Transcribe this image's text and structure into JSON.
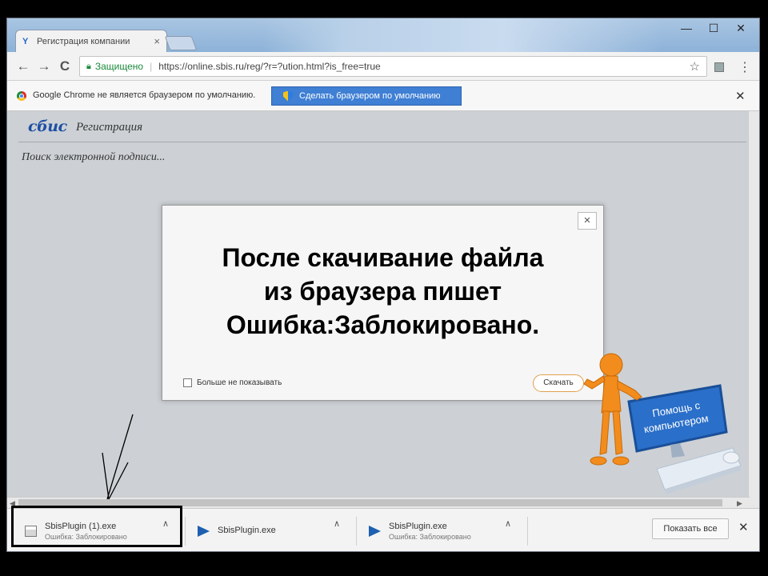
{
  "tab": {
    "title": "Регистрация компании",
    "close": "×"
  },
  "window_controls": [
    "—",
    "☐",
    "✕"
  ],
  "toolbar": {
    "back": "←",
    "forward": "→",
    "reload": "C",
    "secure_label": "Защищено",
    "url": "https://online.sbis.ru/reg/?r=?ution.html?is_free=true",
    "star": "☆",
    "menu": "⋮"
  },
  "infobar": {
    "message": "Google Chrome не является браузером по умолчанию.",
    "button": "Сделать браузером по умолчанию",
    "close": "✕"
  },
  "page": {
    "logo": "сбис",
    "logo_sub": "Регистрация",
    "status": "Поиск электронной подписи..."
  },
  "modal": {
    "caption_lines": [
      "После скачивание файла",
      "из браузера пишет",
      "Ошибка:Заблокировано."
    ],
    "close": "×",
    "dont_show": "Больше не показывать",
    "download_button": "Скачать"
  },
  "figure": {
    "sign_text": [
      "Помощь с",
      "компьютером"
    ]
  },
  "downloads": {
    "items": [
      {
        "name": "SbisPlugin (1).exe",
        "status": "Ошибка: Заблокировано",
        "icon": "generic"
      },
      {
        "name": "SbisPlugin.exe",
        "status": "",
        "icon": "sbis"
      },
      {
        "name": "SbisPlugin.exe",
        "status": "Ошибка: Заблокировано",
        "icon": "sbis"
      }
    ],
    "chevron": "∧",
    "show_all": "Показать все",
    "close": "✕"
  }
}
